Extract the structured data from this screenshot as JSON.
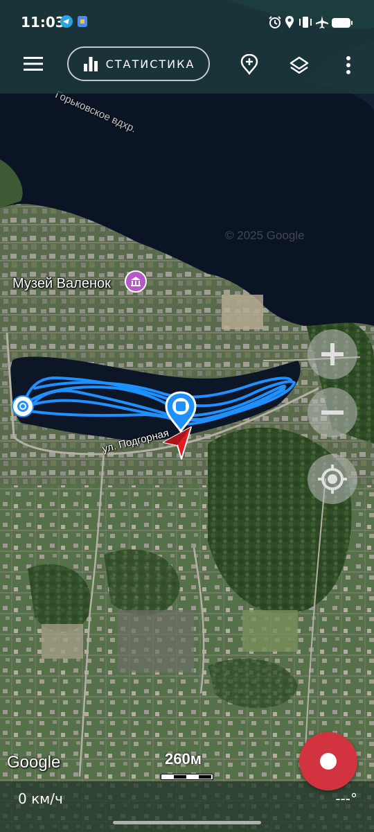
{
  "status_bar": {
    "time": "11:03",
    "left_icons": [
      "telegram-icon",
      "files-icon"
    ],
    "right_icons": [
      "alarm-icon",
      "location-icon",
      "vibrate-icon",
      "airplane-icon",
      "battery-icon"
    ]
  },
  "toolbar": {
    "menu_icon": "hamburger-icon",
    "stats_label": "СТАТИСТИКА",
    "stats_icon": "bar-chart-icon",
    "add_point_icon": "add-location-icon",
    "layers_icon": "layers-icon",
    "more_icon": "more-vert-icon"
  },
  "map": {
    "water_label": "Горьковское вдхр.",
    "copyright": "© 2025 Google",
    "poi_label": "Музей Валенок",
    "street_label": "ул. Подгорная",
    "google_logo": "Google",
    "scale_label": "260м"
  },
  "controls": {
    "zoom_in_icon": "plus-icon",
    "zoom_out_icon": "minus-icon",
    "locate_icon": "gps-target-icon"
  },
  "bottom": {
    "speed": "0 км/ч",
    "heading": "---°"
  },
  "colors": {
    "track": "#1e90ff",
    "record": "#d1343e",
    "water": "#0b1424",
    "toolbar": "#1e3c3e"
  }
}
